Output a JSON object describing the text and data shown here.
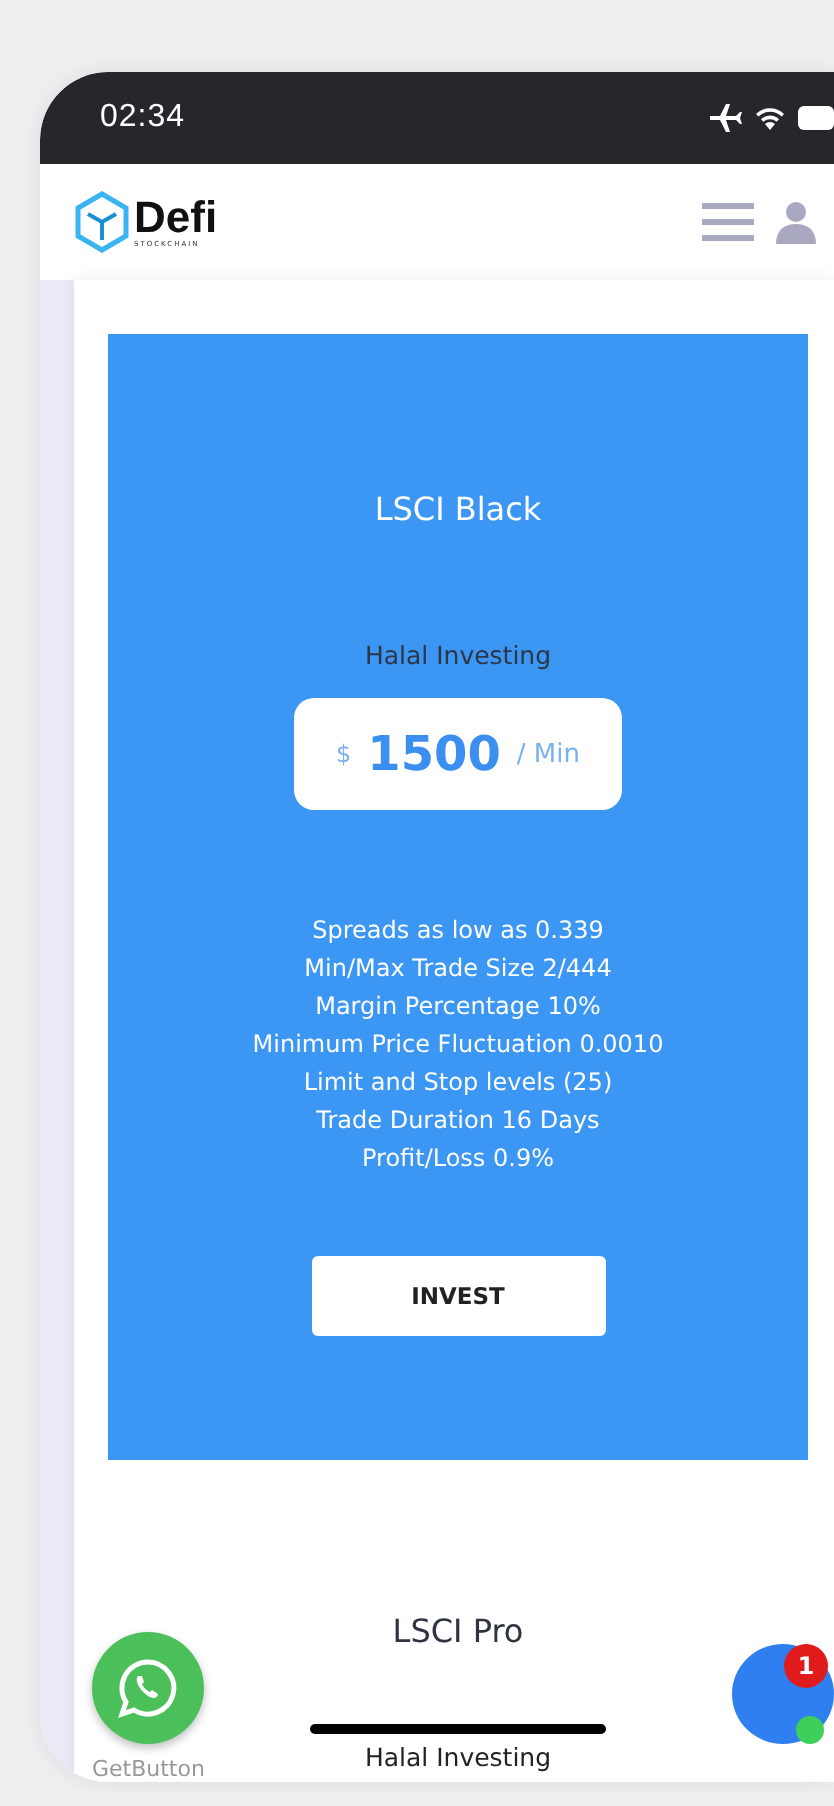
{
  "status_bar": {
    "time": "02:34"
  },
  "header": {
    "logo": "Defi",
    "logo_tagline": "STOCKCHAIN"
  },
  "plans": [
    {
      "highlighted": true,
      "title": "LSCI Black",
      "subtitle": "Halal Investing",
      "price": {
        "currency": "$",
        "amount": "1500",
        "unit": "/ Min"
      },
      "features": [
        "Spreads as low as 0.339",
        "Min/Max Trade Size 2/444",
        "Margin Percentage 10%",
        "Minimum Price Fluctuation 0.0010",
        "Limit and Stop levels (25)",
        "Trade Duration 16 Days",
        "Profit/Loss 0.9%"
      ],
      "button": "INVEST"
    },
    {
      "highlighted": false,
      "title": "LSCI Pro",
      "subtitle": "Halal Investing"
    }
  ],
  "whatsapp_widget": {
    "label": "GetButton"
  },
  "chat_widget": {
    "badge": "1",
    "online": true
  }
}
